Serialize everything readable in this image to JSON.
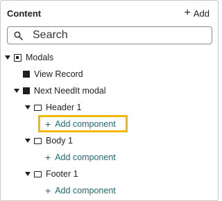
{
  "header": {
    "title": "Content",
    "add_label": "Add",
    "add_icon": "plus-icon"
  },
  "search": {
    "placeholder": "Search",
    "icon": "search-icon"
  },
  "tree": {
    "modals_label": "Modals",
    "view_record_label": "View Record",
    "next_needit_label": "Next NeedIt modal",
    "header1_label": "Header 1",
    "header1_add": "Add component",
    "body1_label": "Body 1",
    "body1_add": "Add component",
    "footer1_label": "Footer 1",
    "footer1_add": "Add component"
  },
  "colors": {
    "link": "#1c6b73",
    "highlight": "#f5b800",
    "text": "#1f1f1f",
    "border": "#c9c9c9"
  }
}
